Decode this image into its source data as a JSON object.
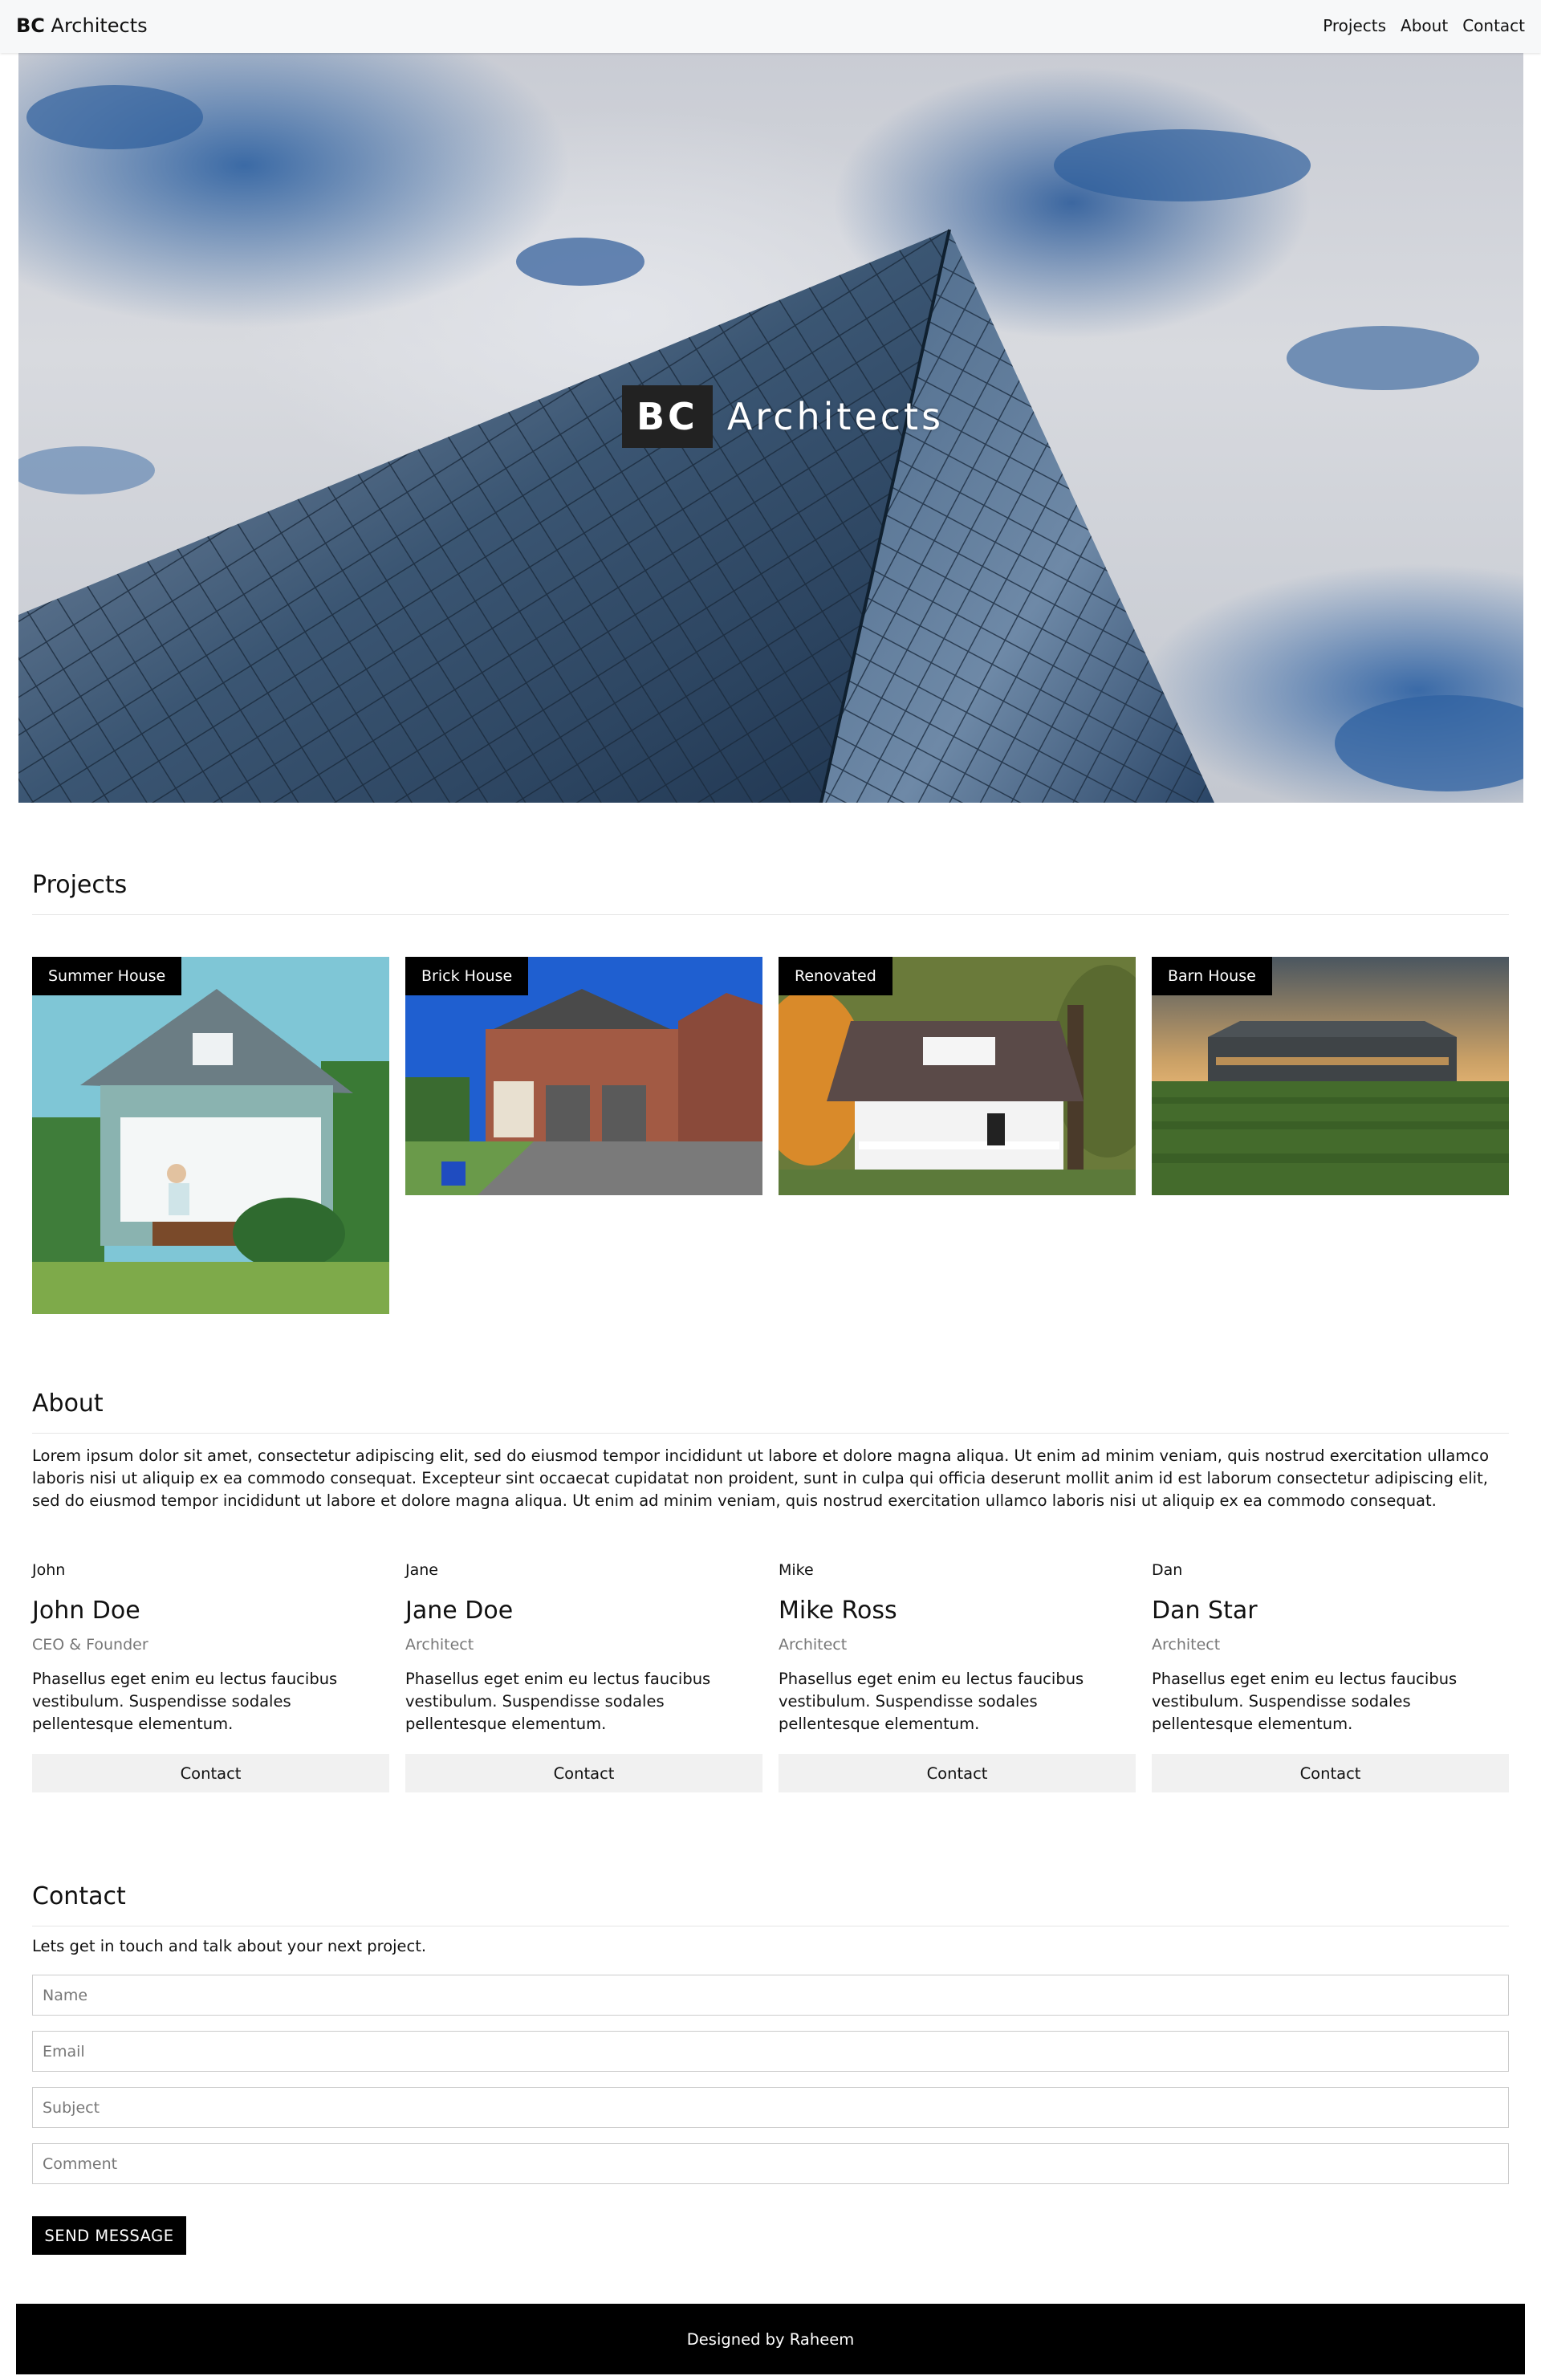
{
  "navbar": {
    "brand_bold": "BC",
    "brand_rest": " Architects",
    "links": [
      "Projects",
      "About",
      "Contact"
    ]
  },
  "hero": {
    "title_bold": "BC",
    "title_rest": "Architects"
  },
  "projects": {
    "title": "Projects",
    "items": [
      {
        "label": "Summer House"
      },
      {
        "label": "Brick House"
      },
      {
        "label": "Renovated"
      },
      {
        "label": "Barn House"
      }
    ]
  },
  "about": {
    "title": "About",
    "text": "Lorem ipsum dolor sit amet, consectetur adipiscing elit, sed do eiusmod tempor incididunt ut labore et dolore magna aliqua. Ut enim ad minim veniam, quis nostrud exercitation ullamco laboris nisi ut aliquip ex ea commodo consequat. Excepteur sint occaecat cupidatat non proident, sunt in culpa qui officia deserunt mollit anim id est laborum consectetur adipiscing elit, sed do eiusmod tempor incididunt ut labore et dolore magna aliqua. Ut enim ad minim veniam, quis nostrud exercitation ullamco laboris nisi ut aliquip ex ea commodo consequat.",
    "team": [
      {
        "nick": "John",
        "name": "John Doe",
        "role": "CEO & Founder",
        "bio": "Phasellus eget enim eu lectus faucibus vestibulum. Suspendisse sodales pellentesque elementum.",
        "button": "Contact"
      },
      {
        "nick": "Jane",
        "name": "Jane Doe",
        "role": "Architect",
        "bio": "Phasellus eget enim eu lectus faucibus vestibulum. Suspendisse sodales pellentesque elementum.",
        "button": "Contact"
      },
      {
        "nick": "Mike",
        "name": "Mike Ross",
        "role": "Architect",
        "bio": "Phasellus eget enim eu lectus faucibus vestibulum. Suspendisse sodales pellentesque elementum.",
        "button": "Contact"
      },
      {
        "nick": "Dan",
        "name": "Dan Star",
        "role": "Architect",
        "bio": "Phasellus eget enim eu lectus faucibus vestibulum. Suspendisse sodales pellentesque elementum.",
        "button": "Contact"
      }
    ]
  },
  "contact": {
    "title": "Contact",
    "intro": "Lets get in touch and talk about your next project.",
    "placeholders": {
      "name": "Name",
      "email": "Email",
      "subject": "Subject",
      "comment": "Comment"
    },
    "send_label": "SEND MESSAGE"
  },
  "footer": {
    "text": "Designed by Raheem"
  },
  "colors": {
    "black": "#000000",
    "button_grey": "#f1f1f1",
    "muted_text": "#777777",
    "navbar_bg": "#f7f8f9"
  }
}
